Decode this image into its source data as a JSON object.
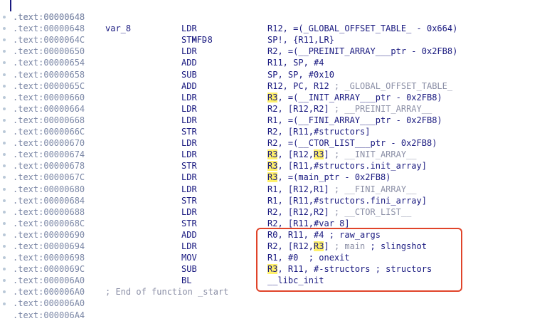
{
  "top_line": {
    "addr": ".text:00000648",
    "label": "var_8",
    "eq": "= -8"
  },
  "lines": [
    {
      "addr": ".text:00000648",
      "mn": "",
      "parts": []
    },
    {
      "addr": ".text:00000648",
      "mn": "LDR",
      "parts": [
        {
          "t": "R12, =(_GLOBAL_OFFSET_TABLE_ - 0x664)"
        }
      ]
    },
    {
      "addr": ".text:0000064C",
      "mn": "STMFD",
      "parts": [
        {
          "t": "SP!, {R11,LR}"
        }
      ]
    },
    {
      "addr": ".text:00000650",
      "mn": "LDR",
      "parts": [
        {
          "t": "R2, =(__PREINIT_ARRAY___ptr - 0x2FB8)"
        }
      ]
    },
    {
      "addr": ".text:00000654",
      "mn": "ADD",
      "parts": [
        {
          "t": "R11, SP, #4"
        }
      ]
    },
    {
      "addr": ".text:00000658",
      "mn": "SUB",
      "parts": [
        {
          "t": "SP, SP, #0x10"
        }
      ]
    },
    {
      "addr": ".text:0000065C",
      "mn": "ADD",
      "parts": [
        {
          "t": "R12, PC, R12 "
        },
        {
          "t": "; _GLOBAL_OFFSET_TABLE_",
          "c": "cm"
        }
      ]
    },
    {
      "addr": ".text:00000660",
      "mn": "LDR",
      "parts": [
        {
          "t": "R3",
          "c": "hl"
        },
        {
          "t": ", =(__INIT_ARRAY___ptr - 0x2FB8)"
        }
      ]
    },
    {
      "addr": ".text:00000664",
      "mn": "LDR",
      "parts": [
        {
          "t": "R2, [R12,R2] "
        },
        {
          "t": "; __PREINIT_ARRAY__",
          "c": "cm"
        }
      ]
    },
    {
      "addr": ".text:00000668",
      "mn": "LDR",
      "parts": [
        {
          "t": "R1, =(__FINI_ARRAY___ptr - 0x2FB8)"
        }
      ]
    },
    {
      "addr": ".text:0000066C",
      "mn": "STR",
      "parts": [
        {
          "t": "R2, [R11,#structors]"
        }
      ]
    },
    {
      "addr": ".text:00000670",
      "mn": "LDR",
      "parts": [
        {
          "t": "R2, =(__CTOR_LIST___ptr - 0x2FB8)"
        }
      ]
    },
    {
      "addr": ".text:00000674",
      "mn": "LDR",
      "parts": [
        {
          "t": "R3",
          "c": "hl"
        },
        {
          "t": ", [R12,"
        },
        {
          "t": "R3",
          "c": "hl"
        },
        {
          "t": "] "
        },
        {
          "t": "; __INIT_ARRAY__",
          "c": "cm"
        }
      ]
    },
    {
      "addr": ".text:00000678",
      "mn": "STR",
      "parts": [
        {
          "t": "R3",
          "c": "hl"
        },
        {
          "t": ", [R11,#structors.init_array]"
        }
      ]
    },
    {
      "addr": ".text:0000067C",
      "mn": "LDR",
      "parts": [
        {
          "t": "R3",
          "c": "hl"
        },
        {
          "t": ", =(main_ptr - 0x2FB8)"
        }
      ]
    },
    {
      "addr": ".text:00000680",
      "mn": "LDR",
      "parts": [
        {
          "t": "R1, [R12,R1] "
        },
        {
          "t": "; __FINI_ARRAY__",
          "c": "cm"
        }
      ]
    },
    {
      "addr": ".text:00000684",
      "mn": "STR",
      "parts": [
        {
          "t": "R1, [R11,#structors.fini_array]"
        }
      ]
    },
    {
      "addr": ".text:00000688",
      "mn": "LDR",
      "parts": [
        {
          "t": "R2, [R12,R2] "
        },
        {
          "t": "; __CTOR_LIST__",
          "c": "cm"
        }
      ]
    },
    {
      "addr": ".text:0000068C",
      "mn": "STR",
      "parts": [
        {
          "t": "R2, [R11,#var_8]"
        }
      ]
    },
    {
      "addr": ".text:00000690",
      "mn": "ADD",
      "parts": [
        {
          "t": "R0, R11, #4 ; raw_args"
        }
      ]
    },
    {
      "addr": ".text:00000694",
      "mn": "LDR",
      "parts": [
        {
          "t": "R2, [R12,"
        },
        {
          "t": "R3",
          "c": "hl"
        },
        {
          "t": "] "
        },
        {
          "t": "; main",
          "c": "cm"
        },
        {
          "t": " ; slingshot"
        }
      ]
    },
    {
      "addr": ".text:00000698",
      "mn": "MOV",
      "parts": [
        {
          "t": "R1, #0  ; onexit"
        }
      ]
    },
    {
      "addr": ".text:0000069C",
      "mn": "SUB",
      "parts": [
        {
          "t": "R3",
          "c": "hl"
        },
        {
          "t": ", R11, #-structors ; structors"
        }
      ]
    },
    {
      "addr": ".text:000006A0",
      "mn": "BL",
      "parts": [
        {
          "t": "__libc_init"
        }
      ]
    },
    {
      "addr": ".text:000006A0",
      "mn": "",
      "endfn": "; End of function _start",
      "parts": []
    },
    {
      "addr": ".text:000006A0",
      "mn": "",
      "parts": []
    },
    {
      "addr": ".text:000006A4",
      "mn": "",
      "parts": []
    }
  ],
  "colors": {
    "highlight": "#fff16a",
    "annotation_box": "#e0442a",
    "text": "#1a1a80",
    "address": "#7b87a6"
  }
}
